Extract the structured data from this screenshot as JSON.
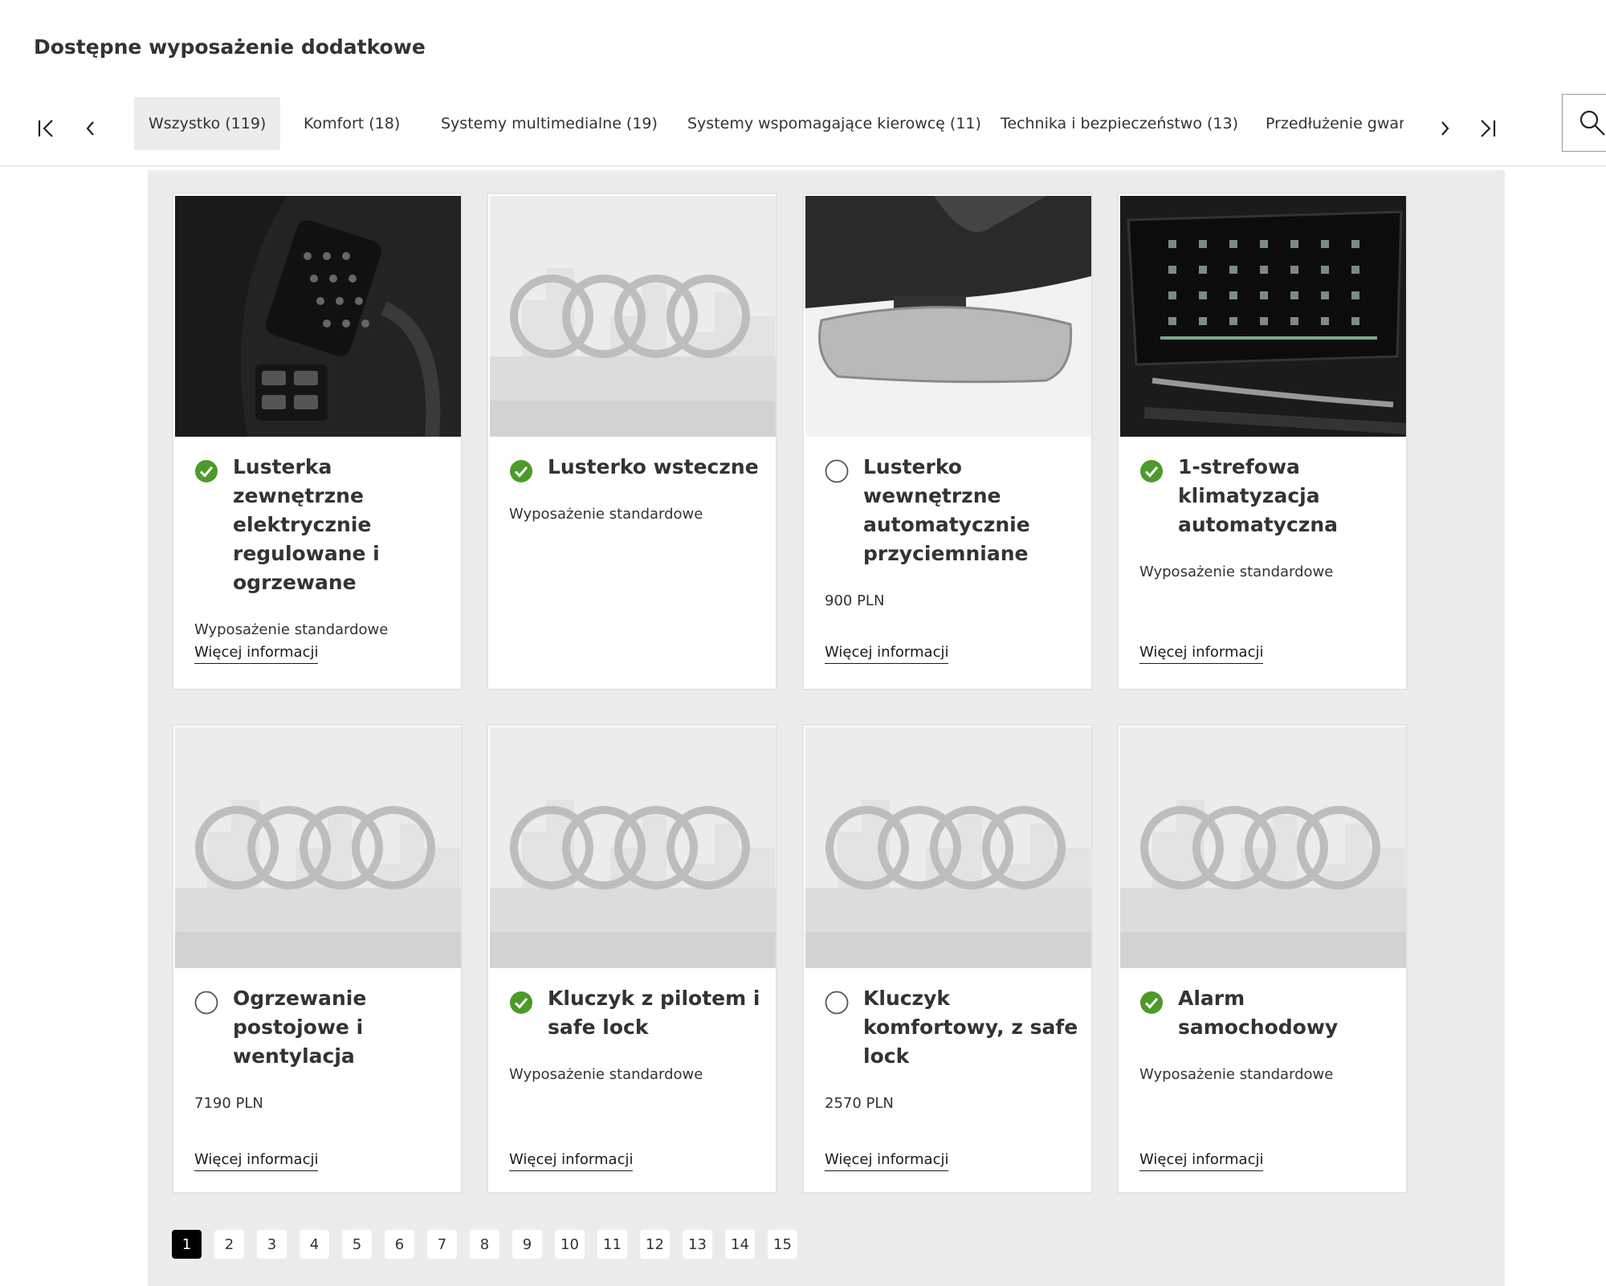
{
  "page_title": "Dostępne wyposażenie dodatkowe",
  "tabs": [
    {
      "label": "Wszystko (119)",
      "active": true
    },
    {
      "label": "Komfort (18)"
    },
    {
      "label": "Systemy multimedialne (19)"
    },
    {
      "label": "Systemy wspomagające kierowcę (11)"
    },
    {
      "label": "Technika i bezpieczeństwo (13)"
    },
    {
      "label": "Przedłużenie gwara"
    }
  ],
  "nav_icons": {
    "first": "skip-to-first-icon",
    "prev": "chevron-left-icon",
    "next": "chevron-right-icon",
    "last": "skip-to-last-icon",
    "search": "search-icon"
  },
  "more_label": "Więcej informacji",
  "cards": [
    {
      "title": "Lusterka zewnętrzne elektrycznie regulowane i ogrzewane",
      "subtitle": "Wyposażenie standardowe",
      "selected": true,
      "image": "door-panel-photo"
    },
    {
      "title": "Lusterko wsteczne",
      "subtitle": "Wyposażenie standardowe",
      "selected": true,
      "image": "audi-placeholder"
    },
    {
      "title": "Lusterko wewnętrzne automatycznie przyciemniane",
      "subtitle": "900 PLN",
      "selected": false,
      "image": "mirror-photo"
    },
    {
      "title": "1-strefowa klimatyzacja automatyczna",
      "subtitle": "Wyposażenie standardowe",
      "selected": true,
      "image": "climate-screen-photo"
    },
    {
      "title": "Ogrzewanie postojowe i wentylacja",
      "subtitle": "7190 PLN",
      "selected": false,
      "image": "audi-placeholder"
    },
    {
      "title": "Kluczyk z pilotem i safe lock",
      "subtitle": "Wyposażenie standardowe",
      "selected": true,
      "image": "audi-placeholder"
    },
    {
      "title": "Kluczyk komfortowy, z safe lock",
      "subtitle": "2570 PLN",
      "selected": false,
      "image": "audi-placeholder"
    },
    {
      "title": "Alarm samochodowy",
      "subtitle": "Wyposażenie standardowe",
      "selected": true,
      "image": "audi-placeholder"
    }
  ],
  "pagination": {
    "current": 1,
    "pages": [
      "1",
      "2",
      "3",
      "4",
      "5",
      "6",
      "7",
      "8",
      "9",
      "10",
      "11",
      "12",
      "13",
      "14",
      "15"
    ]
  },
  "colors": {
    "check_green": "#4c9a2a",
    "panel_bg": "#ececec",
    "active_page_bg": "#000000"
  }
}
